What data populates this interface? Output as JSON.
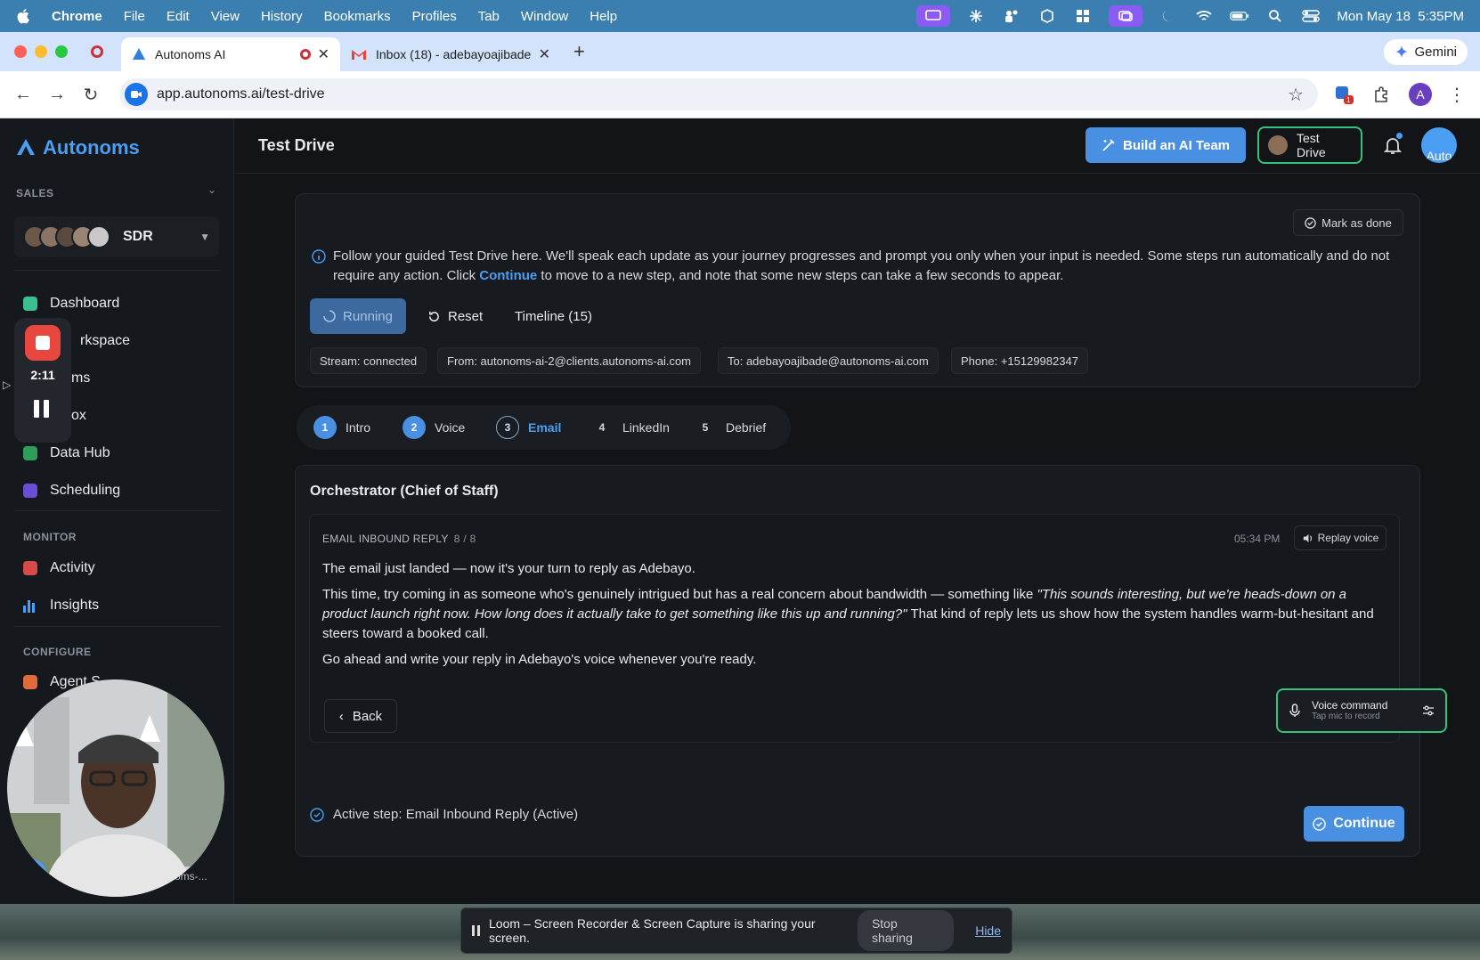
{
  "menubar": {
    "app": "Chrome",
    "items": [
      "File",
      "Edit",
      "View",
      "History",
      "Bookmarks",
      "Profiles",
      "Tab",
      "Window",
      "Help"
    ],
    "datetime": "Mon May 18  5:35PM"
  },
  "tabs": [
    {
      "title": "Autonoms AI"
    },
    {
      "title": "Inbox (18) - adebayoajibade@"
    }
  ],
  "gemini_label": "Gemini",
  "address": {
    "url": "app.autonoms.ai/test-drive",
    "extension_badge": "1",
    "profile_initial": "A"
  },
  "sidebar": {
    "brand": "Autonoms",
    "sales_label": "SALES",
    "team_name": "SDR",
    "nav": [
      {
        "label": "Dashboard",
        "icon": "dashboard-icon",
        "color": "#3bbf8f"
      },
      {
        "label": "rkspace",
        "icon": "workspace-icon",
        "color": "#e0a83b"
      },
      {
        "label": "ms",
        "icon": "teams-icon",
        "color": "#4a9ff5"
      },
      {
        "label": "ox",
        "icon": "inbox-icon",
        "color": "#9b59d6"
      },
      {
        "label": "Data Hub",
        "icon": "data-hub-icon",
        "color": "#2e9e5a"
      },
      {
        "label": "Scheduling",
        "icon": "scheduling-icon",
        "color": "#6a4fd6"
      }
    ],
    "monitor_label": "MONITOR",
    "monitor": [
      {
        "label": "Activity",
        "icon": "activity-icon",
        "color": "#d64a4a"
      },
      {
        "label": "Insights",
        "icon": "insights-icon",
        "color": "#4a9ff5"
      }
    ],
    "configure_label": "CONFIGURE",
    "configure": [
      {
        "label": "Agent S",
        "icon": "agent-icon",
        "color": "#e06a3b"
      }
    ],
    "footer_text": "oms-..."
  },
  "loom": {
    "timer": "2:11"
  },
  "header": {
    "title": "Test Drive",
    "build_label": "Build an AI Team",
    "test_drive_label": "Test Drive",
    "avatar_text": "Auto"
  },
  "guide": {
    "mark_done": "Mark as done",
    "info_part1": "Follow your guided Test Drive here. We'll speak each update as your journey progresses and prompt you only when your input is needed. Some steps run automatically and do not require any action. Click ",
    "info_highlight": "Continue",
    "info_part2": " to move to a new step, and note that some new steps can take a few seconds to appear.",
    "running_label": "Running",
    "reset_label": "Reset",
    "timeline_label": "Timeline (15)",
    "chips": [
      "Stream: connected",
      "From: autonoms-ai-2@clients.autonoms-ai.com",
      "To: adebayoajibade@autonoms-ai.com",
      "Phone: +15129982347"
    ]
  },
  "steps": [
    {
      "num": "1",
      "label": "Intro",
      "state": "done"
    },
    {
      "num": "2",
      "label": "Voice",
      "state": "done"
    },
    {
      "num": "3",
      "label": "Email",
      "state": "active"
    },
    {
      "num": "4",
      "label": "LinkedIn",
      "state": "todo"
    },
    {
      "num": "5",
      "label": "Debrief",
      "state": "todo"
    }
  ],
  "orchestrator": {
    "title": "Orchestrator (Chief of Staff)",
    "eyebrow": "EMAIL INBOUND REPLY",
    "count": "8 / 8",
    "time": "05:34 PM",
    "replay_label": "Replay voice",
    "para1": "The email just landed — now it's your turn to reply as Adebayo.",
    "para2_a": "This time, try coming in as someone who's genuinely intrigued but has a real concern about bandwidth — something like ",
    "para2_quote": "\"This sounds interesting, but we're heads-down on a product launch right now. How long does it actually take to get something like this up and running?\"",
    "para2_b": " That kind of reply lets us show how the system handles warm-but-hesitant and steers toward a booked call.",
    "para3": "Go ahead and write your reply in Adebayo's voice whenever you're ready.",
    "back_label": "Back",
    "voice_title": "Voice command",
    "voice_sub": "Tap mic to record",
    "active_step": "Active step: Email Inbound Reply (Active)",
    "continue_label": "Continue"
  },
  "loom_banner": {
    "message": "Loom – Screen Recorder & Screen Capture is sharing your screen.",
    "stop_label": "Stop sharing",
    "hide_label": "Hide"
  }
}
